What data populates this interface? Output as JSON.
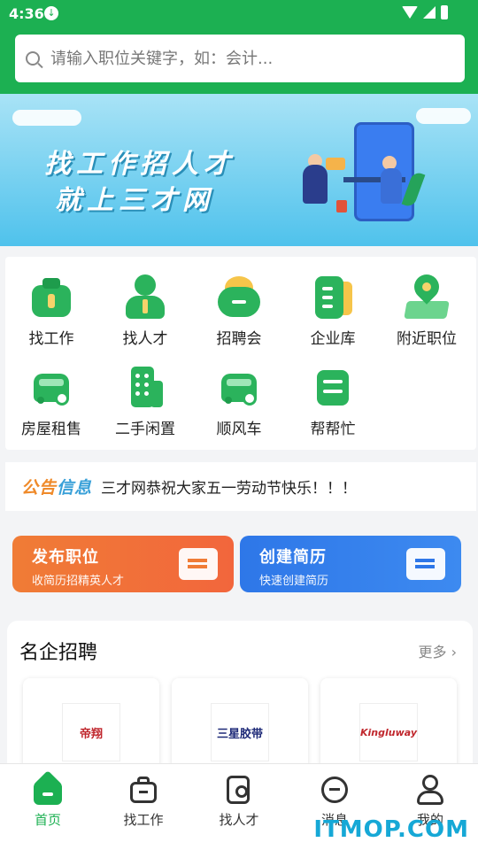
{
  "status_bar": {
    "time": "4:36"
  },
  "search": {
    "placeholder": "请输入职位关键字，如：会计..."
  },
  "banner": {
    "line1": "找工作招人才",
    "line2": "就上三才网"
  },
  "grid": [
    {
      "label": "找工作",
      "icon": "briefcase-icon"
    },
    {
      "label": "找人才",
      "icon": "person-icon"
    },
    {
      "label": "招聘会",
      "icon": "chat-bubbles-icon"
    },
    {
      "label": "企业库",
      "icon": "document-icon"
    },
    {
      "label": "附近职位",
      "icon": "location-pin-icon"
    },
    {
      "label": "房屋租售",
      "icon": "house-car-icon"
    },
    {
      "label": "二手闲置",
      "icon": "building-icon"
    },
    {
      "label": "顺风车",
      "icon": "car-icon"
    },
    {
      "label": "帮帮忙",
      "icon": "help-box-icon"
    }
  ],
  "notice": {
    "tag_part1": "公告",
    "tag_part2": "信息",
    "text": "三才网恭祝大家五一劳动节快乐！！！"
  },
  "cards": [
    {
      "title": "发布职位",
      "subtitle": "收简历招精英人才",
      "color": "#f07c36"
    },
    {
      "title": "创建简历",
      "subtitle": "快速创建简历",
      "color": "#2e77e8"
    }
  ],
  "famous": {
    "title": "名企招聘",
    "more": "更多",
    "companies": [
      {
        "logo_text": "帝翔"
      },
      {
        "logo_text": "三星胶带"
      },
      {
        "logo_text": "Kingluway"
      }
    ]
  },
  "tabbar": [
    {
      "label": "首页",
      "icon": "home-icon",
      "active": true
    },
    {
      "label": "找工作",
      "icon": "briefcase-icon",
      "active": false
    },
    {
      "label": "找人才",
      "icon": "search-document-icon",
      "active": false
    },
    {
      "label": "消息",
      "icon": "message-icon",
      "active": false
    },
    {
      "label": "我的",
      "icon": "user-icon",
      "active": false
    }
  ],
  "watermark": "ITMOP.COM",
  "colors": {
    "brand_green": "#1cb052",
    "orange": "#f07c36",
    "blue": "#2e77e8"
  }
}
